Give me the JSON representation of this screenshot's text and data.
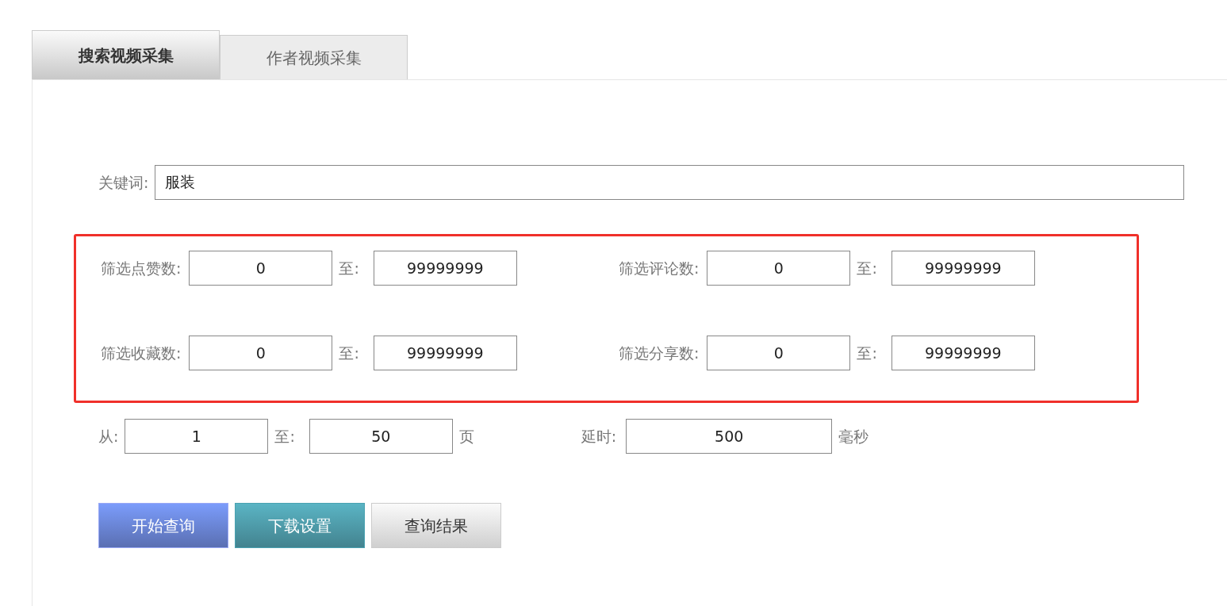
{
  "tabs": [
    {
      "label": "搜索视频采集",
      "selected": true
    },
    {
      "label": "作者视频采集",
      "selected": false
    }
  ],
  "keyword": {
    "label": "关键词:",
    "value": "服装"
  },
  "filters": {
    "highlighted": true,
    "rows": [
      [
        {
          "label": "筛选点赞数:",
          "from": "0",
          "to_label": "至:",
          "to": "99999999"
        },
        {
          "label": "筛选评论数:",
          "from": "0",
          "to_label": "至:",
          "to": "99999999"
        }
      ],
      [
        {
          "label": "筛选收藏数:",
          "from": "0",
          "to_label": "至:",
          "to": "99999999"
        },
        {
          "label": "筛选分享数:",
          "from": "0",
          "to_label": "至:",
          "to": "99999999"
        }
      ]
    ]
  },
  "pages": {
    "from_label": "从:",
    "from": "1",
    "to_label": "至:",
    "to": "50",
    "unit": "页"
  },
  "delay": {
    "label": "延时:",
    "value": "500",
    "unit": "毫秒"
  },
  "buttons": [
    {
      "label": "开始查询",
      "kind": "primary"
    },
    {
      "label": "下载设置",
      "kind": "info"
    },
    {
      "label": "查询结果",
      "kind": "plain"
    }
  ]
}
